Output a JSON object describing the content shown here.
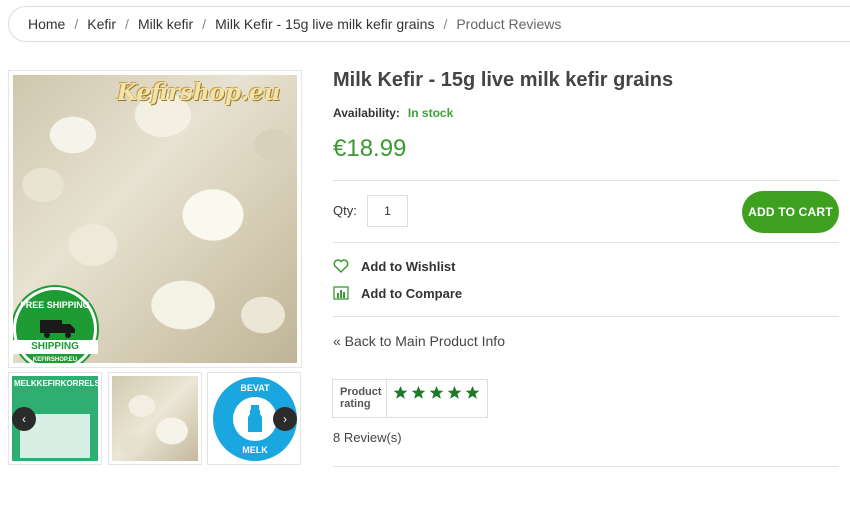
{
  "breadcrumb": {
    "items": [
      "Home",
      "Kefir",
      "Milk kefir",
      "Milk Kefir - 15g live milk kefir grains"
    ],
    "current": "Product Reviews",
    "separator": "/"
  },
  "gallery": {
    "watermark": "Kefirshop.eu",
    "badge": {
      "top_text": "FREE SHIPPING",
      "banner_text": "SHIPPING",
      "bottom_text": "KEFIRSHOP.EU"
    },
    "thumb1_label": "MELKKEFIRKORRELS",
    "thumb1_sub": "",
    "thumb3_top": "BEVAT",
    "thumb3_bottom": "MELK",
    "prev_arrow": "‹",
    "next_arrow": "›"
  },
  "product": {
    "title": "Milk Kefir - 15g live milk kefir grains",
    "availability_label": "Availability:",
    "availability_value": "In stock",
    "price": "€18.99",
    "qty_label": "Qty:",
    "qty_value": "1",
    "add_to_cart": "ADD TO CART",
    "wishlist": "Add to Wishlist",
    "compare": "Add to Compare",
    "back_link": "« Back to Main Product Info",
    "rating_label": "Product rating",
    "rating_stars": 5,
    "reviews": "8 Review(s)"
  },
  "colors": {
    "accent_green": "#3ea01f",
    "price_green": "#3a9a32",
    "stock_green": "#3aa335",
    "star_green": "#1e7a28"
  }
}
